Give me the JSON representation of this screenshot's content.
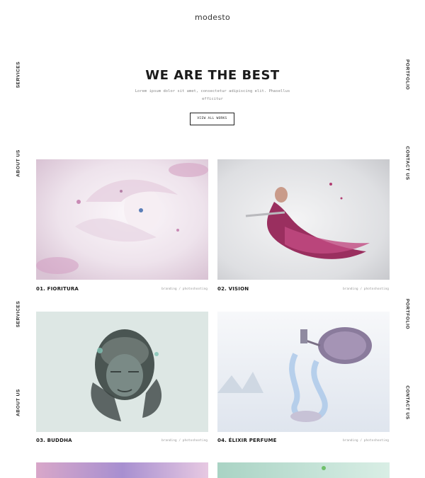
{
  "logo": "modesto",
  "nav": {
    "left": [
      "SERVICES",
      "ABOUT US"
    ],
    "right": [
      "PORTFOLIO",
      "CONTACT US"
    ]
  },
  "hero": {
    "title": "WE ARE THE BEST",
    "subtitle_line1": "Lorem ipsum dolor sit amet, consectetur adipiscing elit. Phasellus",
    "subtitle_line2": "efficitur",
    "button": "VIEW ALL WORKS"
  },
  "works": [
    {
      "title": "01. FIORITURA",
      "tags": "branding / photoshooting"
    },
    {
      "title": "02. VISION",
      "tags": "branding / photoshooting"
    },
    {
      "title": "03. BUDDHA",
      "tags": "branding / photoshooting"
    },
    {
      "title": "04. ÉLIXIR PERFUME",
      "tags": "branding / photoshooting"
    }
  ],
  "colors": {
    "text": "#1b1b1b",
    "muted": "#999999",
    "accent_pink": "#d98ab4",
    "accent_teal": "#8fc7bb"
  }
}
